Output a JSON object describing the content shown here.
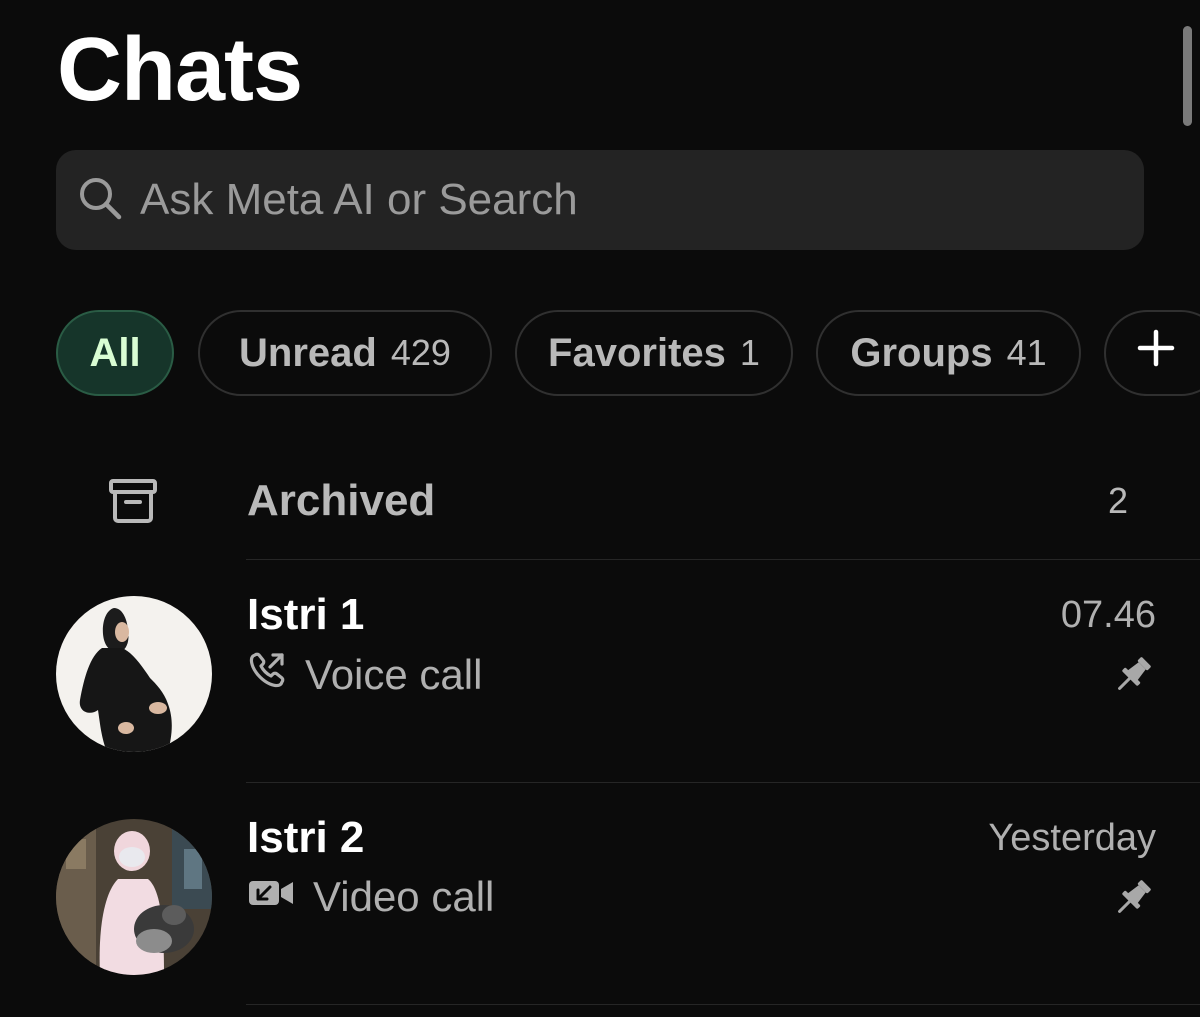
{
  "header": {
    "title": "Chats"
  },
  "search": {
    "placeholder": "Ask Meta AI or Search",
    "value": ""
  },
  "filters": [
    {
      "label": "All",
      "count": "",
      "active": true
    },
    {
      "label": "Unread",
      "count": "429",
      "active": false
    },
    {
      "label": "Favorites",
      "count": "1",
      "active": false
    },
    {
      "label": "Groups",
      "count": "41",
      "active": false
    }
  ],
  "add_filter_icon": "plus-icon",
  "archived": {
    "label": "Archived",
    "count": "2",
    "icon": "archive-icon"
  },
  "chats": [
    {
      "name": "Istri 1",
      "subtitle": "Voice call",
      "subtitle_icon": "outgoing-voice-call-icon",
      "time": "07.46",
      "pinned": true
    },
    {
      "name": "Istri 2",
      "subtitle": "Video call",
      "subtitle_icon": "outgoing-video-call-icon",
      "time": "Yesterday",
      "pinned": true
    }
  ],
  "colors": {
    "background": "#0b0b0b",
    "search_bg": "#232323",
    "active_chip_bg": "#16352a",
    "active_chip_text": "#d9fdd3",
    "muted_text": "#b0b0b0"
  }
}
